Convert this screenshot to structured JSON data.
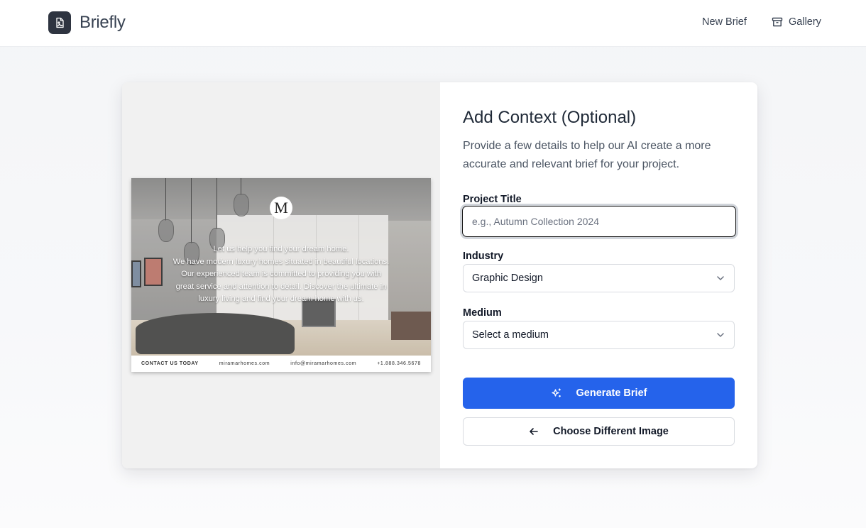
{
  "app": {
    "name": "Briefly"
  },
  "nav": {
    "new_brief": "New Brief",
    "gallery": "Gallery"
  },
  "preview": {
    "monogram": "M",
    "copy_lines": [
      "Let us help you find your dream home.",
      "We have modern luxury homes situated in beautiful locations.",
      "Our experienced team is committed to providing you with",
      "great service and attention to detail. Discover the ultimate in",
      "luxury living and find your dream home with us."
    ],
    "footer": {
      "contact": "CONTACT US TODAY",
      "website": "miramarhomes.com",
      "email": "info@miramarhomes.com",
      "phone": "+1.888.346.5678"
    }
  },
  "form": {
    "title": "Add Context (Optional)",
    "description": "Provide a few details to help our AI create a more accurate and relevant brief for your project.",
    "project_title": {
      "label": "Project Title",
      "placeholder": "e.g., Autumn Collection 2024",
      "value": ""
    },
    "industry": {
      "label": "Industry",
      "selected": "Graphic Design"
    },
    "medium": {
      "label": "Medium",
      "selected": "Select a medium"
    },
    "generate_label": "Generate Brief",
    "back_label": "Choose Different Image"
  },
  "colors": {
    "primary": "#2563eb",
    "logo_bg": "#2e3440"
  },
  "icons": {
    "logo": "image-file-icon",
    "gallery": "archive-icon",
    "chevron": "chevron-down-icon",
    "sparkle": "sparkles-icon",
    "back": "arrow-left-icon"
  }
}
